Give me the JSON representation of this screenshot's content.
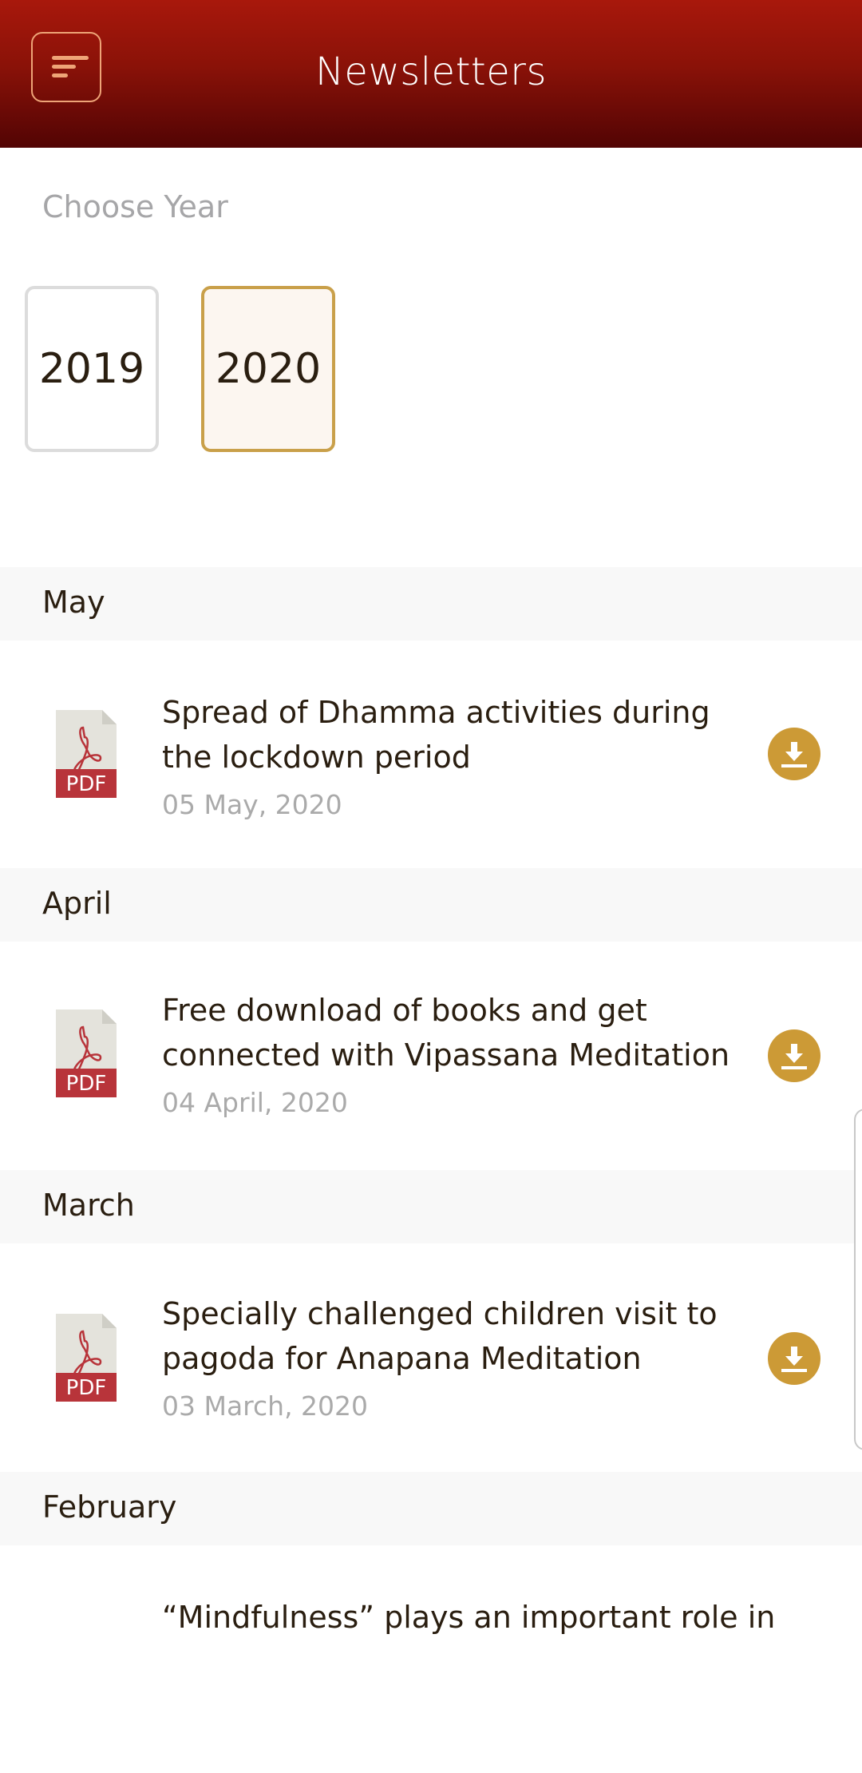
{
  "header": {
    "title": "Newsletters",
    "menu_icon": "menu-lines-icon"
  },
  "year_picker": {
    "label": "Choose Year",
    "years": [
      {
        "label": "2019",
        "selected": false
      },
      {
        "label": "2020",
        "selected": true
      }
    ]
  },
  "colors": {
    "header_top": "#a8180c",
    "header_bottom": "#520404",
    "accent_gold": "#cc9a36",
    "pdf_red": "#b8343a"
  },
  "sections": [
    {
      "month": "May",
      "items": [
        {
          "title": "Spread of Dhamma activities during the lockdown period",
          "date": "05 May, 2020",
          "file_badge": "PDF"
        }
      ]
    },
    {
      "month": "April",
      "items": [
        {
          "title": "Free download of books and get connected with Vipassana Meditation",
          "date": "04 April, 2020",
          "file_badge": "PDF"
        }
      ]
    },
    {
      "month": "March",
      "items": [
        {
          "title": "Specially challenged children visit to pagoda for Anapana Meditation",
          "date": "03 March, 2020",
          "file_badge": "PDF"
        }
      ]
    },
    {
      "month": "February",
      "items": [
        {
          "title": "“Mindfulness” plays an important role in",
          "date": "",
          "file_badge": ""
        }
      ]
    }
  ]
}
